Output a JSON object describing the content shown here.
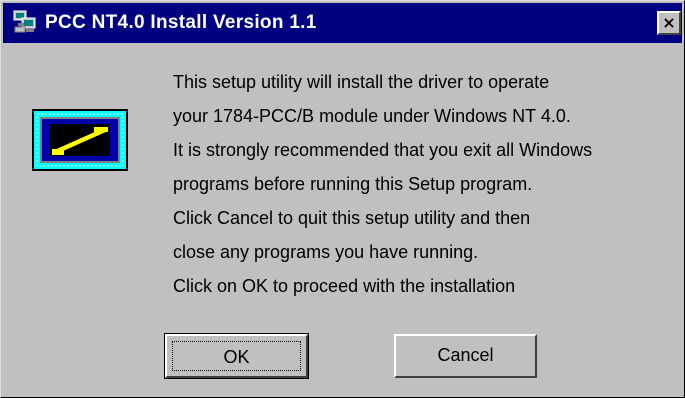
{
  "window": {
    "title": "PCC NT4.0 Install Version 1.1",
    "close_glyph": "×",
    "icon": "installer-computer-icon"
  },
  "message": {
    "lines": [
      "This setup utility will install the driver to operate",
      "your 1784-PCC/B module under Windows NT 4.0.",
      "It is strongly recommended that you exit all Windows",
      "programs before running this Setup program.",
      "Click Cancel to quit this setup utility and then",
      "close any programs you have running.",
      "Click on OK to proceed with the installation"
    ]
  },
  "buttons": {
    "ok_label": "OK",
    "cancel_label": "Cancel"
  },
  "colors": {
    "titlebar": "#000080",
    "face": "#c0c0c0",
    "icon_frame": "#00ffff",
    "icon_card": "#ffff00"
  }
}
